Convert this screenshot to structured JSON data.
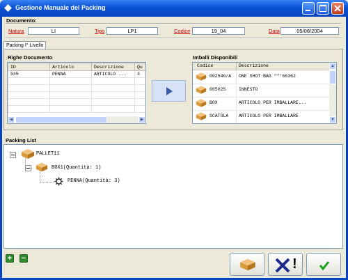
{
  "window": {
    "title": "Gestione Manuale del Packing"
  },
  "documento": {
    "section_label": "Documento:",
    "natura_label": "Natura",
    "natura_value": "LI",
    "tipo_label": "Tipo",
    "tipo_value": "LP1",
    "codice_label": "Codice",
    "codice_value": "19_04",
    "data_label": "Data",
    "data_value": "05/08/2004"
  },
  "tab": {
    "label": "Packing I° Livello"
  },
  "righe": {
    "title": "Righe Documento",
    "columns": [
      "ID",
      "Articolo",
      "Descrizione",
      "Qu"
    ],
    "rows": [
      [
        "535",
        "PENNA",
        "ARTICOLO ...",
        "3"
      ]
    ]
  },
  "imballi": {
    "title": "Imballi Disponibili",
    "columns": [
      "Codice",
      "Descrizione"
    ],
    "rows": [
      [
        "002546/A",
        "ONE SHOT BAG \"\"'66362"
      ],
      [
        "065025",
        "INNESTO"
      ],
      [
        "BOX",
        "ARTICOLO PER IMBALLARE..."
      ],
      [
        "SCATOLA",
        "ARTICOLO PER IMBALLARE"
      ]
    ]
  },
  "packing_list": {
    "title": "Packing List",
    "nodes": [
      {
        "label": "PALLET11"
      },
      {
        "label": "BOX1(Quantità: 1)"
      },
      {
        "label": "PENNA(Quantità: 3)"
      }
    ]
  },
  "buttons": {
    "add": "+",
    "remove": "−",
    "cancel_mark": "!"
  },
  "colors": {
    "titlebar": "#0A52D6",
    "window_bg": "#ECE9D8",
    "required_label": "#CC0000",
    "confirm_check": "#1E9E1E"
  }
}
